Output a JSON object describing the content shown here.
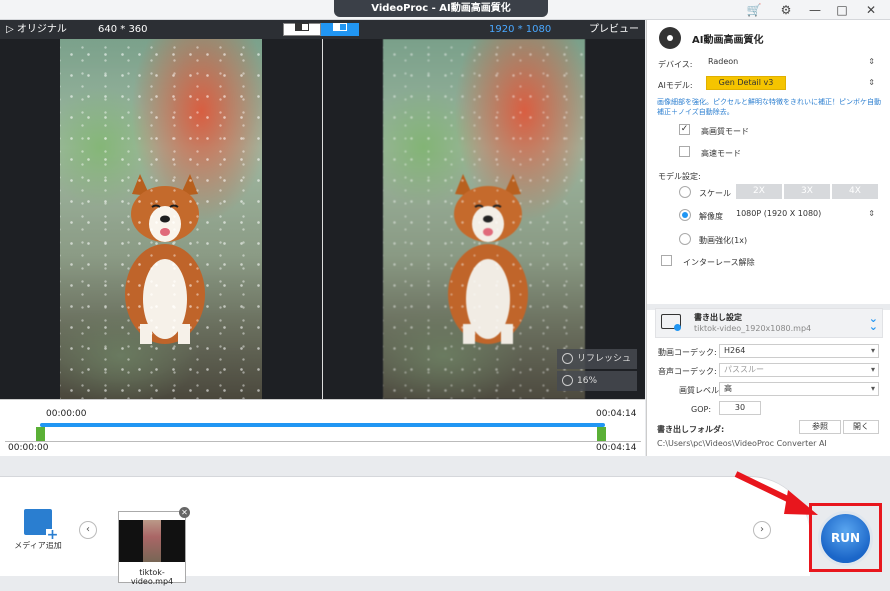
{
  "window": {
    "title": "VideoProc - AI動画高画質化"
  },
  "preview": {
    "original_label": "オリジナル",
    "original_res": "640 * 360",
    "output_res": "1920 * 1080",
    "preview_label": "プレビュー",
    "refresh_label": "リフレッシュ",
    "zoom_label": "16%"
  },
  "timeline": {
    "start_top": "00:00:00",
    "end_top": "00:04:14",
    "start_bottom": "00:00:00",
    "end_bottom": "00:04:14"
  },
  "panel": {
    "title": "AI動画高画質化",
    "device_label": "デバイス:",
    "device_value": "Radeon",
    "model_label": "AIモデル:",
    "model_value": "Gen Detail v3",
    "description": "画像細部を強化。ピクセルと鮮明な特徴をきれいに補正！ピンボケ自動補正＋ノイズ自動除去。",
    "hq_mode": "高画質モード",
    "fast_mode": "高速モード",
    "model_settings": "モデル設定:",
    "scale_label": "スケール",
    "scale_options": [
      "2X",
      "3X",
      "4X"
    ],
    "resolution_label": "解像度",
    "resolution_value": "1080P (1920 X 1080)",
    "interp_label": "動画強化(1x)",
    "deinterlace_label": "インターレース解除"
  },
  "export": {
    "title": "書き出し設定",
    "filename": "tiktok-video_1920x1080.mp4",
    "video_codec_label": "動画コーデック:",
    "video_codec_value": "H264",
    "audio_codec_label": "音声コーデック:",
    "audio_codec_value": "パススルー",
    "quality_label": "画質レベル:",
    "quality_value": "高",
    "gop_label": "GOP:",
    "gop_value": "30",
    "folder_label": "書き出しフォルダ:",
    "browse_label": "参照",
    "open_label": "開く",
    "folder_path": "C:\\Users\\pc\\Videos\\VideoProc Converter AI"
  },
  "media": {
    "add_label": "メディア追加",
    "file_name": "tiktok-video.mp4"
  },
  "run_label": "RUN"
}
